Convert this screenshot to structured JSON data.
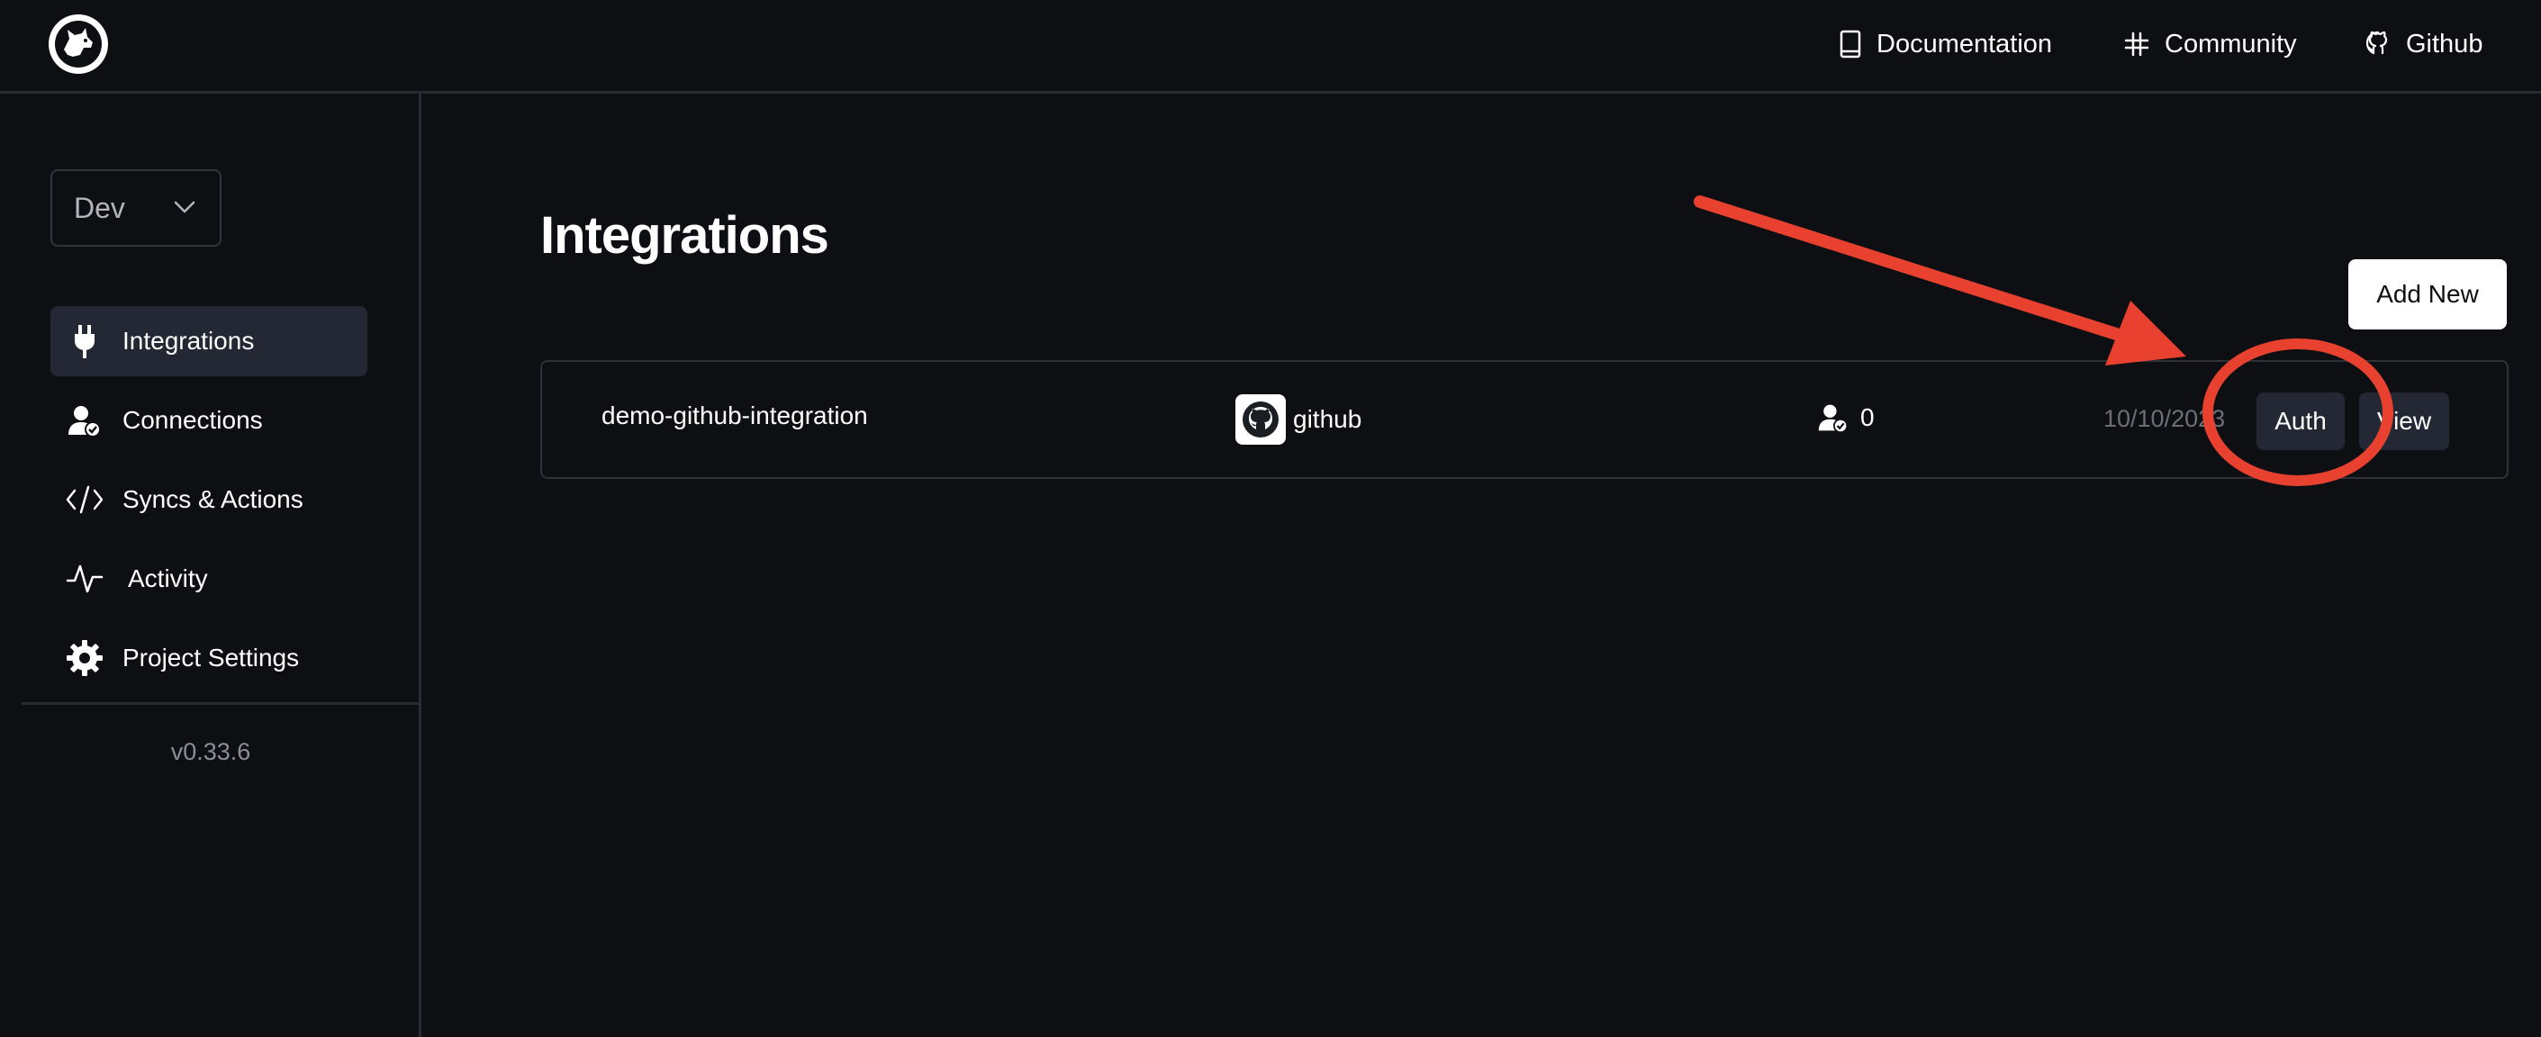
{
  "topbar": {
    "logo_icon": "dog-logo-icon",
    "links": [
      {
        "label": "Documentation",
        "icon": "book-icon"
      },
      {
        "label": "Community",
        "icon": "slack-icon"
      },
      {
        "label": "Github",
        "icon": "github-icon"
      }
    ]
  },
  "sidebar": {
    "environment": "Dev",
    "items": [
      {
        "label": "Integrations",
        "icon": "plug-icon",
        "active": true
      },
      {
        "label": "Connections",
        "icon": "user-check-icon",
        "active": false
      },
      {
        "label": "Syncs & Actions",
        "icon": "code-icon",
        "active": false
      },
      {
        "label": "Activity",
        "icon": "pulse-icon",
        "active": false
      },
      {
        "label": "Project Settings",
        "icon": "gear-icon",
        "active": false
      }
    ],
    "version": "v0.33.6"
  },
  "main": {
    "title": "Integrations",
    "add_new_label": "Add New",
    "rows": [
      {
        "name": "demo-github-integration",
        "provider": "github",
        "connections": "0",
        "date": "10/10/2023",
        "auth_label": "Auth",
        "view_label": "View"
      }
    ]
  },
  "colors": {
    "background": "#0e0f13",
    "active_nav": "#232834",
    "annotation_red": "#e8412f"
  }
}
